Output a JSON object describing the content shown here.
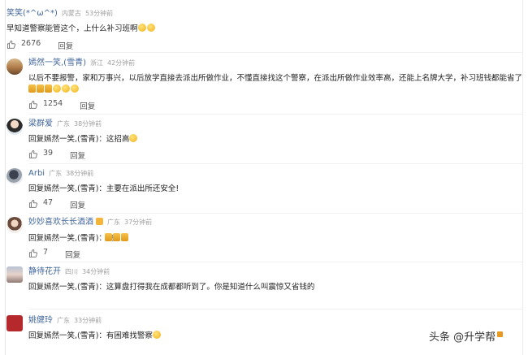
{
  "comments": [
    {
      "author": "笑笑(*^ω^*)",
      "location": "内蒙古",
      "time": "53分钟前",
      "text": "早知道警察能管这个，上什么补习班啊",
      "likes": "2676",
      "reply_label": "回复"
    },
    {
      "author": "嫣然一笑,(雪青)",
      "location": "浙江",
      "time": "42分钟前",
      "text": "以后不要报警，家和万事兴，以后放学直接去派出所做作业，不懂直接找这个警察，在派出所做作业效率高，还能上名牌大学，补习班钱都能省了",
      "likes": "1254",
      "reply_label": "回复"
    },
    {
      "author": "梁群爱",
      "location": "广东",
      "time": "38分钟前",
      "text": "回复嫣然一笑,(雪青)：这招高",
      "likes": "39",
      "reply_label": "回复"
    },
    {
      "author": "Arbi",
      "location": "广东",
      "time": "38分钟前",
      "text": "回复嫣然一笑,(雪青)：主要在派出所还安全!",
      "likes": "47",
      "reply_label": "回复"
    },
    {
      "author": "妙妙喜欢长长酒酒",
      "location": "广东",
      "time": "37分钟前",
      "text": "回复嫣然一笑,(雪青)：高",
      "likes": "7",
      "reply_label": "回复"
    },
    {
      "author": "静待花开",
      "location": "四川",
      "time": "34分钟前",
      "text": "回复嫣然一笑,(雪青)：这算盘打得我在成都都听到了。你是知道什么叫震惊又省钱的",
      "likes": "",
      "reply_label": ""
    },
    {
      "author": "姚健玲",
      "location": "广东",
      "time": "33分钟前",
      "text": "回复嫣然一笑,(雪青)：有困难找警察",
      "likes": "",
      "reply_label": ""
    }
  ],
  "watermark": "头条 @升学帮",
  "colors": {
    "name": "#406599",
    "meta": "#a0a0a0",
    "text": "#222222"
  }
}
